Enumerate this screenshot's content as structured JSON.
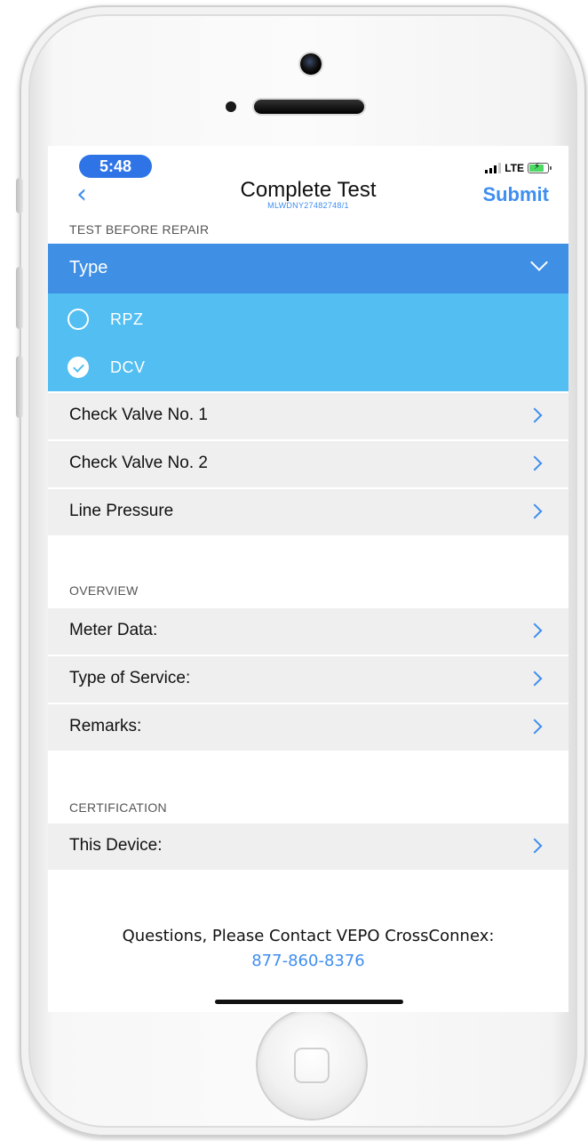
{
  "status_bar": {
    "time": "5:48",
    "network": "LTE"
  },
  "nav": {
    "title": "Complete Test",
    "subtitle": "MLWDNY27482748/1",
    "submit_label": "Submit"
  },
  "test_before_repair": {
    "header": "TEST BEFORE REPAIR",
    "type_label": "Type",
    "options": [
      {
        "label": "RPZ",
        "selected": false
      },
      {
        "label": "DCV",
        "selected": true
      }
    ],
    "rows": [
      "Check Valve No. 1",
      "Check Valve No. 2",
      "Line Pressure"
    ]
  },
  "overview": {
    "header": "OVERVIEW",
    "rows": [
      "Meter Data:",
      "Type of Service:",
      "Remarks:"
    ]
  },
  "certification": {
    "header": "CERTIFICATION",
    "rows": [
      "This Device:"
    ]
  },
  "footer": {
    "question": "Questions, Please Contact VEPO CrossConnex:",
    "phone": "877-860-8376"
  },
  "colors": {
    "accent": "#3f8ef0",
    "type_bar": "#3f8fe4",
    "options_bg": "#53bef1",
    "row_bg": "#efefef"
  }
}
